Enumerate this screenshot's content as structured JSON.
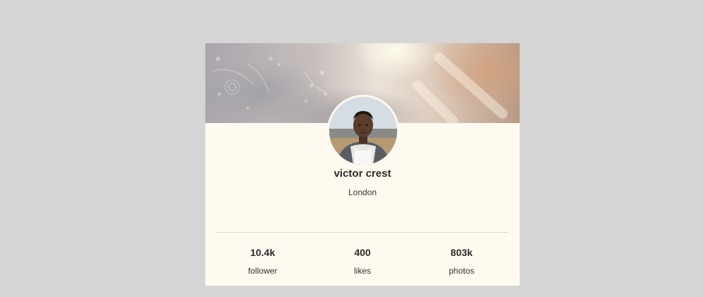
{
  "profile": {
    "name": "victor crest",
    "location": "London"
  },
  "stats": [
    {
      "value": "10.4k",
      "label": "follower"
    },
    {
      "value": "400",
      "label": "likes"
    },
    {
      "value": "803k",
      "label": "photos"
    }
  ],
  "colors": {
    "page_background": "#d5d5d5",
    "card_background": "#fefaf0",
    "text_primary": "#2b2b2b",
    "divider": "#d8d4cc"
  }
}
